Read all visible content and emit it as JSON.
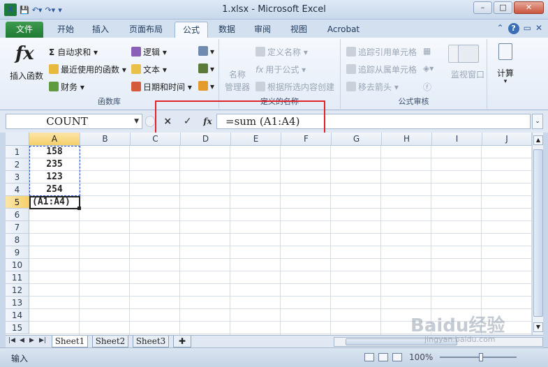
{
  "window": {
    "title": "1.xlsx - Microsoft Excel"
  },
  "tabs": [
    "文件",
    "开始",
    "插入",
    "页面布局",
    "公式",
    "数据",
    "审阅",
    "视图",
    "Acrobat"
  ],
  "active_tab": "公式",
  "ribbon": {
    "function_library": {
      "label": "函数库",
      "insert_function": "插入函数",
      "autosum": "自动求和",
      "recent": "最近使用的函数",
      "financial": "财务",
      "logical": "逻辑",
      "text": "文本",
      "datetime": "日期和时间"
    },
    "defined_names": {
      "label": "定义的名称",
      "name_manager_1": "名称",
      "name_manager_2": "管理器",
      "define_name": "定义名称",
      "use_in_formula": "用于公式",
      "create_from_selection": "根据所选内容创建"
    },
    "formula_auditing": {
      "label": "公式审核",
      "trace_precedents": "追踪引用单元格",
      "trace_dependents": "追踪从属单元格",
      "remove_arrows": "移去箭头",
      "watch_window": "监视窗口"
    },
    "calculation": {
      "label": "计算"
    }
  },
  "formula_bar": {
    "name_box": "COUNT",
    "cancel": "×",
    "enter": "✓",
    "fx": "fx",
    "formula": "=sum (A1:A4)"
  },
  "columns": [
    "A",
    "B",
    "C",
    "D",
    "E",
    "F",
    "G",
    "H",
    "I",
    "J"
  ],
  "rows": [
    "1",
    "2",
    "3",
    "4",
    "5",
    "6",
    "7",
    "8",
    "9",
    "10",
    "11",
    "12",
    "13",
    "14",
    "15"
  ],
  "cells": {
    "A1": "158",
    "A2": "235",
    "A3": "123",
    "A4": "254",
    "A5": "(A1:A4)"
  },
  "sheets": [
    "Sheet1",
    "Sheet2",
    "Sheet3"
  ],
  "active_sheet": "Sheet1",
  "status": {
    "mode": "输入",
    "zoom": "100%"
  },
  "watermark": {
    "brand": "Baidu经验",
    "url": "jingyan.baidu.com"
  },
  "colors": {
    "file_tab": "#1f7a33",
    "highlight_box": "#e0232b",
    "selection_header": "#f6cf6a"
  }
}
